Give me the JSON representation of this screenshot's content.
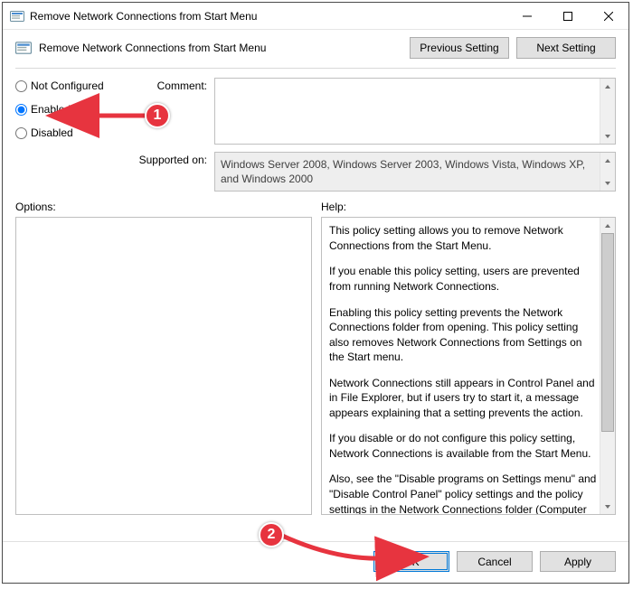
{
  "window": {
    "title": "Remove Network Connections from Start Menu"
  },
  "toolbar": {
    "label": "Remove Network Connections from Start Menu",
    "prev": "Previous Setting",
    "next": "Next Setting"
  },
  "radios": {
    "not_configured": "Not Configured",
    "enabled": "Enabled",
    "disabled": "Disabled",
    "selected": "enabled"
  },
  "fields": {
    "comment_label": "Comment:",
    "comment_value": "",
    "supported_label": "Supported on:",
    "supported_value": "Windows Server 2008, Windows Server 2003, Windows Vista, Windows XP, and Windows 2000"
  },
  "panes": {
    "options_label": "Options:",
    "help_label": "Help:",
    "help_paragraphs": [
      "This policy setting allows you to remove Network Connections from the Start Menu.",
      "If you enable this policy setting, users are prevented from running Network Connections.",
      "Enabling this policy setting prevents the Network Connections folder from opening. This policy setting also removes Network Connections from Settings on the Start menu.",
      "Network Connections still appears in Control Panel and in File Explorer, but if users try to start it, a message appears explaining that a setting prevents the action.",
      "If you disable or do not configure this policy setting, Network Connections is available from the Start Menu.",
      "Also, see the \"Disable programs on Settings menu\" and \"Disable Control Panel\" policy settings and the policy settings in the Network Connections folder (Computer Configuration and User Configuration\\Administrative Templates\\Network\\Network"
    ]
  },
  "buttons": {
    "ok": "OK",
    "cancel": "Cancel",
    "apply": "Apply"
  },
  "annotations": {
    "one": "1",
    "two": "2"
  }
}
